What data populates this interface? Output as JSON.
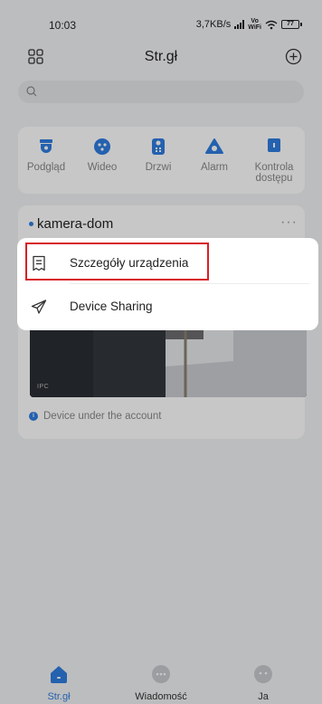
{
  "status_bar": {
    "time": "10:03",
    "speed": "3,7KB/s",
    "volte_top": "Vo",
    "volte_bottom": "WiFi",
    "battery": "77"
  },
  "header": {
    "title": "Str.gł",
    "left_icon": "grid-icon",
    "right_icon": "plus-circle-icon"
  },
  "search": {
    "icon": "search-icon"
  },
  "categories": [
    {
      "label": "Podgląd",
      "icon": "camera-dome-icon"
    },
    {
      "label": "Wideo",
      "icon": "video-cluster-icon"
    },
    {
      "label": "Drzwi",
      "icon": "doorbell-icon"
    },
    {
      "label": "Alarm",
      "icon": "alarm-icon"
    },
    {
      "label": "Kontrola dostępu",
      "icon": "access-control-icon"
    }
  ],
  "device": {
    "name": "kamera-dom",
    "more": "···",
    "camera_label": "IPC",
    "account_note": "Device under the account"
  },
  "menu": {
    "items": [
      {
        "label": "Szczegóły urządzenia",
        "icon": "document-icon"
      },
      {
        "label": "Device Sharing",
        "icon": "send-icon"
      }
    ]
  },
  "bottom_nav": [
    {
      "label": "Str.gł",
      "icon": "home-icon",
      "active": true
    },
    {
      "label": "Wiadomość",
      "icon": "message-icon",
      "active": false
    },
    {
      "label": "Ja",
      "icon": "user-icon",
      "active": false
    }
  ],
  "colors": {
    "accent": "#2f7de1",
    "highlight": "#d81f26",
    "background": "#f1f2f4"
  }
}
